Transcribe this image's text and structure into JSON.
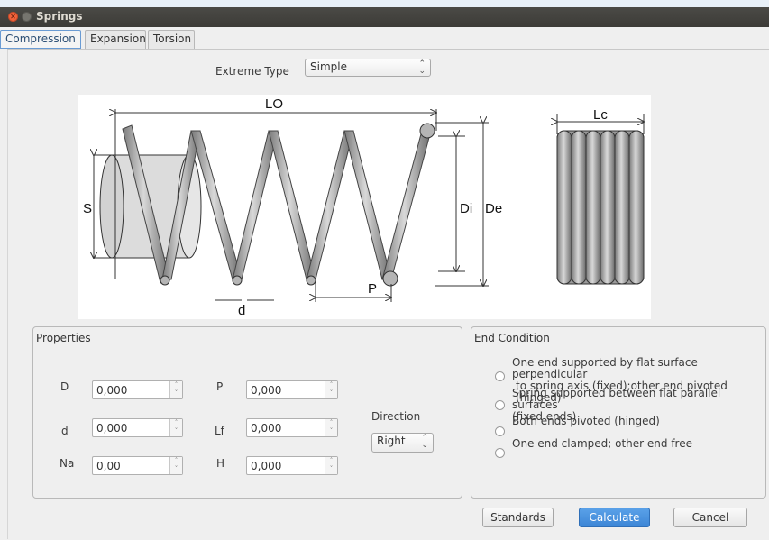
{
  "window": {
    "title": "Springs"
  },
  "tabs": [
    "Compression",
    "Expansion",
    "Torsion"
  ],
  "extreme_type": {
    "label": "Extreme Type",
    "value": "Simple"
  },
  "diagram": {
    "labels": {
      "lo": "LO",
      "lc": "Lc",
      "s": "S",
      "di": "Di",
      "de": "De",
      "d": "d",
      "p": "P"
    }
  },
  "properties": {
    "title": "Properties",
    "fields": {
      "D": {
        "label": "D",
        "value": "0,000"
      },
      "d": {
        "label": "d",
        "value": "0,000"
      },
      "Na": {
        "label": "Na",
        "value": "0,00"
      },
      "P": {
        "label": "P",
        "value": "0,000"
      },
      "Lf": {
        "label": "Lf",
        "value": "0,000"
      },
      "H": {
        "label": "H",
        "value": "0,000"
      }
    },
    "direction": {
      "label": "Direction",
      "value": "Right"
    }
  },
  "end_condition": {
    "title": "End Condition",
    "options": [
      {
        "line1": "One end supported by flat surface perpendicular",
        "line2": "to spring axis (fixed);other end pivoted (hinged)"
      },
      {
        "line1": "Spring supported between flat parallel surfaces",
        "line2": "(fixed ends)"
      },
      {
        "line1": "Both ends pivoted (hinged)",
        "line2": ""
      },
      {
        "line1": "One end clamped; other end free",
        "line2": ""
      }
    ]
  },
  "buttons": {
    "standards": "Standards",
    "calculate": "Calculate",
    "cancel": "Cancel"
  },
  "colors": {
    "accent": "#3d86d6",
    "titlebar": "#3c3b37",
    "close": "#f0623a"
  }
}
